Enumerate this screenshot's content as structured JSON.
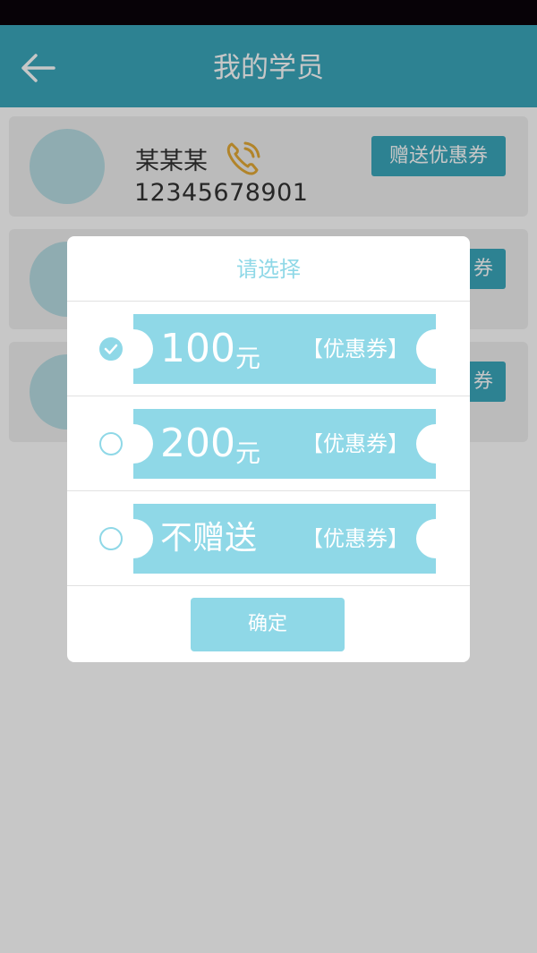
{
  "header": {
    "title": "我的学员",
    "back_icon": "arrow-left-icon"
  },
  "students": [
    {
      "name": "某某某",
      "phone": "12345678901",
      "gift_label": "赠送优惠券"
    },
    {
      "gift_label_visible": "券"
    },
    {
      "gift_label_visible": "券"
    }
  ],
  "modal": {
    "title": "请选择",
    "options": [
      {
        "amount": "100",
        "unit": "元",
        "label": "【优惠券】",
        "selected": true
      },
      {
        "amount": "200",
        "unit": "元",
        "label": "【优惠券】",
        "selected": false
      },
      {
        "text": "不赠送",
        "label": "【优惠券】",
        "selected": false
      }
    ],
    "confirm_label": "确定"
  },
  "colors": {
    "primary": "#3aa7bc",
    "accent_light": "#8fd8e7",
    "phone_icon": "#e3aa36",
    "avatar": "#b8dde3"
  }
}
